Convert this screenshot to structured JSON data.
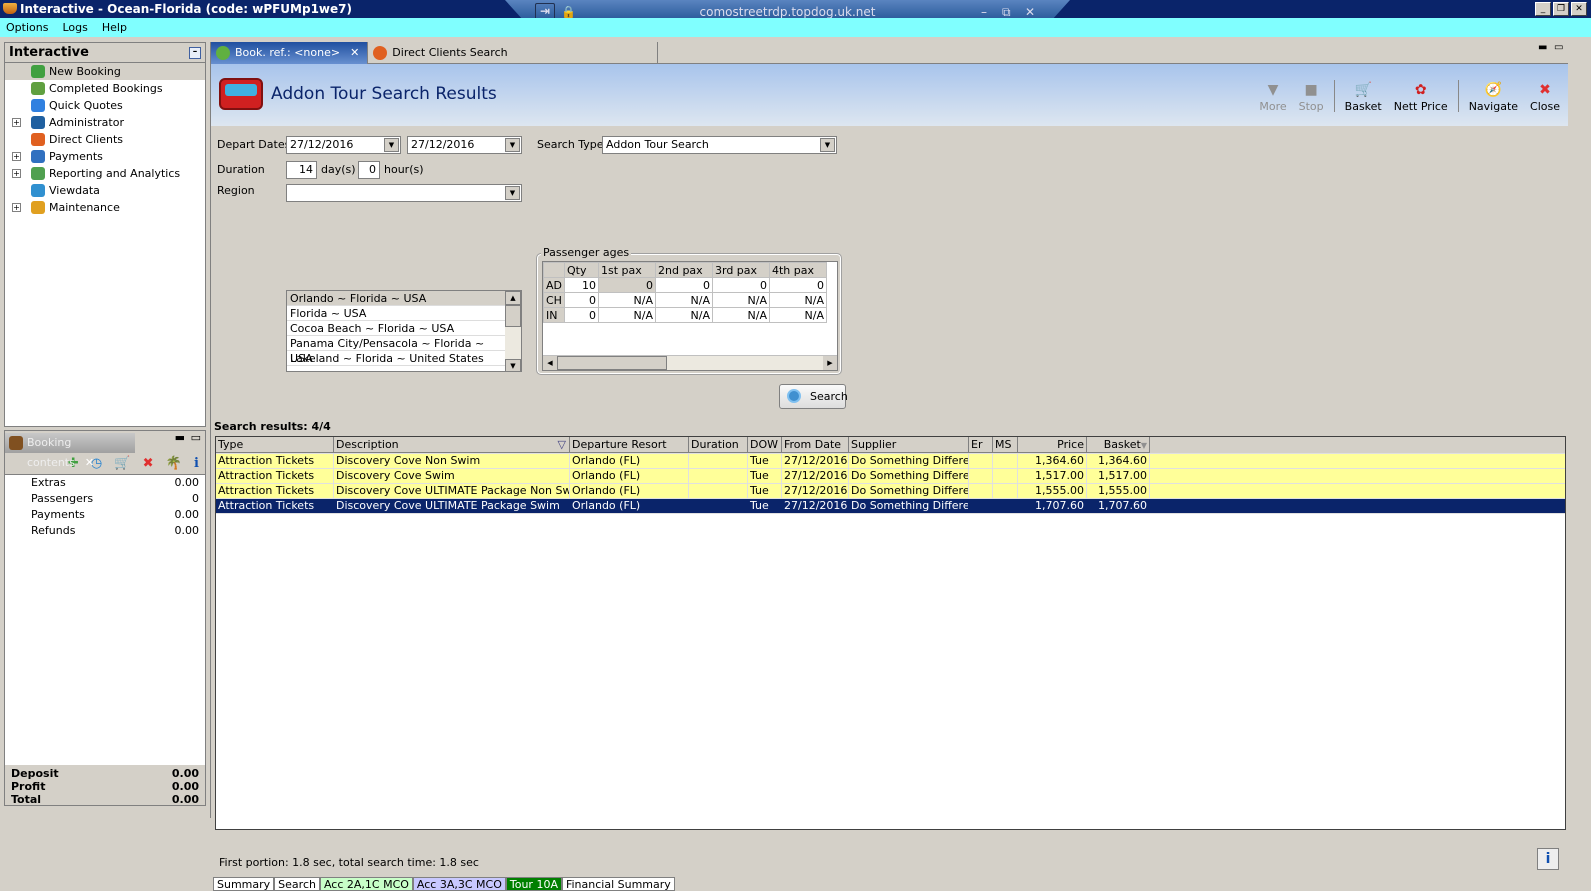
{
  "window": {
    "title": "Interactive - Ocean-Florida (code: wPFUMp1we7)",
    "rdp_host": "comostreetrdp.topdog.uk.net"
  },
  "menu": [
    "Options",
    "Logs",
    "Help"
  ],
  "nav": {
    "title": "Interactive",
    "items": [
      {
        "label": "New Booking",
        "expandable": false,
        "color": "#40a040"
      },
      {
        "label": "Completed Bookings",
        "expandable": false,
        "color": "#60a040"
      },
      {
        "label": "Quick Quotes",
        "expandable": false,
        "color": "#3080e0"
      },
      {
        "label": "Administrator",
        "expandable": true,
        "color": "#2060a0"
      },
      {
        "label": "Direct Clients",
        "expandable": false,
        "color": "#e06020"
      },
      {
        "label": "Payments",
        "expandable": true,
        "color": "#3070c0"
      },
      {
        "label": "Reporting and Analytics",
        "expandable": true,
        "color": "#50a050"
      },
      {
        "label": "Viewdata",
        "expandable": false,
        "color": "#3090d0"
      },
      {
        "label": "Maintenance",
        "expandable": true,
        "color": "#e0a020"
      }
    ]
  },
  "booking_contents": {
    "title": "Booking contents",
    "rows": [
      {
        "label": "Extras",
        "value": "0.00"
      },
      {
        "label": "Passengers",
        "value": "0"
      },
      {
        "label": "Payments",
        "value": "0.00"
      },
      {
        "label": "Refunds",
        "value": "0.00"
      }
    ],
    "summary": [
      {
        "label": "Deposit",
        "value": "0.00"
      },
      {
        "label": "Profit",
        "value": "0.00"
      },
      {
        "label": "Total",
        "value": "0.00"
      }
    ]
  },
  "tabs": [
    {
      "label": "Book. ref.: <none>"
    },
    {
      "label": "Direct Clients Search"
    }
  ],
  "header": {
    "title": "Addon Tour Search Results"
  },
  "toolbar": {
    "more": "More",
    "stop": "Stop",
    "basket": "Basket",
    "nett_price": "Nett Price",
    "navigate": "Navigate",
    "close": "Close"
  },
  "form": {
    "depart_dates_label": "Depart Dates",
    "date_from": "27/12/2016",
    "date_to": "27/12/2016",
    "duration_label": "Duration",
    "days": "14",
    "days_unit": "day(s)",
    "hours": "0",
    "hours_unit": "hour(s)",
    "region_label": "Region",
    "region_value": "",
    "regions": [
      "Orlando ~ Florida ~ USA",
      "Florida ~ USA",
      "Cocoa Beach ~ Florida ~ USA",
      "Panama City/Pensacola ~  Florida  ~ USA",
      "Lakeland ~ Florida ~ United States"
    ],
    "search_type_label": "Search Type",
    "search_type": "Addon Tour Search",
    "pax_label": "Passenger ages",
    "pax_headers": [
      "",
      "Qty",
      "1st pax",
      "2nd pax",
      "3rd pax",
      "4th pax"
    ],
    "pax_rows": [
      [
        "AD",
        "10",
        "0",
        "0",
        "0",
        "0"
      ],
      [
        "CH",
        "0",
        "N/A",
        "N/A",
        "N/A",
        "N/A"
      ],
      [
        "IN",
        "0",
        "N/A",
        "N/A",
        "N/A",
        "N/A"
      ]
    ],
    "search_button": "Search"
  },
  "results": {
    "label": "Search results: 4/4",
    "columns": [
      "Type",
      "Description",
      "Departure Resort",
      "Duration",
      "DOW",
      "From Date",
      "Supplier",
      "Er",
      "MS",
      "Price",
      "Basket"
    ],
    "rows": [
      [
        "Attraction Tickets",
        "Discovery Cove  Non Swim",
        "Orlando (FL)",
        "",
        "Tue",
        "27/12/2016",
        "Do Something Different",
        "",
        "",
        "1,364.60",
        "1,364.60"
      ],
      [
        "Attraction Tickets",
        "Discovery Cove   Swim",
        "Orlando (FL)",
        "",
        "Tue",
        "27/12/2016",
        "Do Something Different",
        "",
        "",
        "1,517.00",
        "1,517.00"
      ],
      [
        "Attraction Tickets",
        "Discovery Cove ULTIMATE Package  Non Swim",
        "Orlando (FL)",
        "",
        "Tue",
        "27/12/2016",
        "Do Something Different",
        "",
        "",
        "1,555.00",
        "1,555.00"
      ],
      [
        "Attraction Tickets",
        "Discovery Cove ULTIMATE Package  Swim",
        "Orlando (FL)",
        "",
        "Tue",
        "27/12/2016",
        "Do Something Different",
        "",
        "",
        "1,707.60",
        "1,707.60"
      ]
    ],
    "selected_row": 3
  },
  "status": "First portion: 1.8 sec, total search time: 1.8 sec",
  "bottom_tabs": [
    {
      "label": "Summary",
      "color": "#ffffff",
      "fg": "#000000"
    },
    {
      "label": "Search",
      "color": "#ffffff",
      "fg": "#000000"
    },
    {
      "label": "Acc 2A,1C MCO",
      "color": "#c8ffc8",
      "fg": "#000000"
    },
    {
      "label": "Acc 3A,3C MCO",
      "color": "#c8c8ff",
      "fg": "#000000"
    },
    {
      "label": "Tour 10A",
      "color": "#008000",
      "fg": "#ffffff"
    },
    {
      "label": "Financial Summary",
      "color": "#ffffff",
      "fg": "#000000"
    }
  ]
}
